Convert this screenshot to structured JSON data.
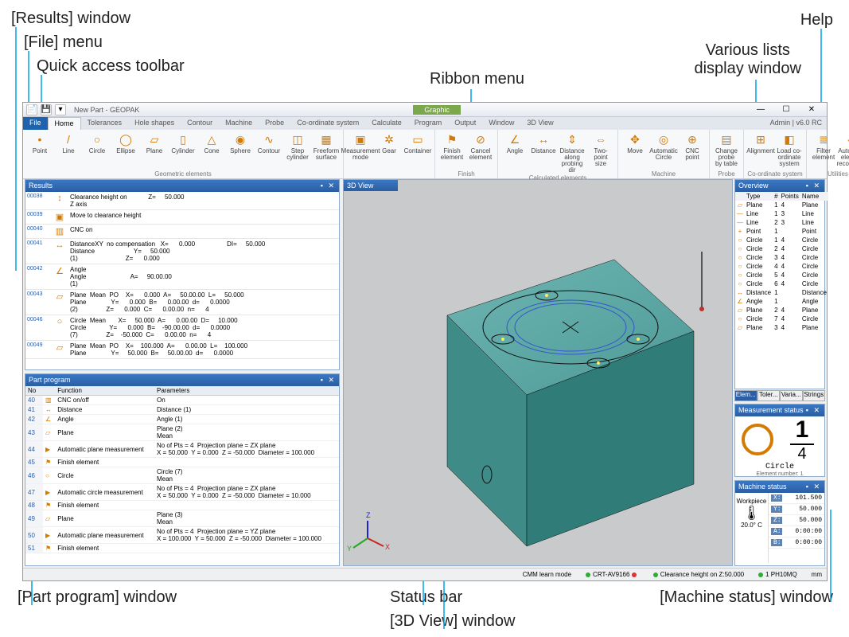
{
  "callouts": {
    "results_win": "[Results] window",
    "file_menu": "[File] menu",
    "quick_access": "Quick access toolbar",
    "ribbon_menu": "Ribbon menu",
    "help": "Help",
    "lists_window": "Various lists\ndisplay window",
    "part_program": "[Part program] window",
    "status_bar": "Status bar",
    "view3d": "[3D View] window",
    "meas_status": "[Measurement status] window",
    "mach_status": "[Machine status] window"
  },
  "title": "New Part - GEOPAK",
  "graphic_badge": "Graphic",
  "user": "Admin | v6.0 RC",
  "tabs": [
    "File",
    "Home",
    "Tolerances",
    "Hole shapes",
    "Contour",
    "Machine",
    "Probe",
    "Co-ordinate system",
    "Calculate",
    "Program",
    "Output",
    "Window",
    "3D View"
  ],
  "active_tab": 1,
  "ribbon": {
    "groups": [
      {
        "label": "Geometric elements",
        "buttons": [
          {
            "name": "Point",
            "icon": "•"
          },
          {
            "name": "Line",
            "icon": "/"
          },
          {
            "name": "Circle",
            "icon": "○"
          },
          {
            "name": "Ellipse",
            "icon": "◯"
          },
          {
            "name": "Plane",
            "icon": "▱"
          },
          {
            "name": "Cylinder",
            "icon": "▯"
          },
          {
            "name": "Cone",
            "icon": "△"
          },
          {
            "name": "Sphere",
            "icon": "◉"
          },
          {
            "name": "Contour",
            "icon": "∿"
          },
          {
            "name": "Step\ncylinder",
            "icon": "◫"
          },
          {
            "name": "Freeform\nsurface",
            "icon": "▦"
          }
        ]
      },
      {
        "label": "",
        "buttons": [
          {
            "name": "Measurement\nmode",
            "icon": "▣"
          },
          {
            "name": "Gear",
            "icon": "✲"
          },
          {
            "name": "Container",
            "icon": "▭"
          }
        ]
      },
      {
        "label": "Finish",
        "buttons": [
          {
            "name": "Finish\nelement",
            "icon": "⚑"
          },
          {
            "name": "Cancel\nelement",
            "icon": "⊘"
          }
        ]
      },
      {
        "label": "Calculated elements",
        "buttons": [
          {
            "name": "Angle",
            "icon": "∠"
          },
          {
            "name": "Distance",
            "icon": "↔"
          },
          {
            "name": "Distance along\nprobing dir",
            "icon": "⇕"
          },
          {
            "name": "Two-point\nsize",
            "icon": "⇔"
          }
        ]
      },
      {
        "label": "Machine",
        "buttons": [
          {
            "name": "Move",
            "icon": "✥"
          },
          {
            "name": "Automatic\nCircle",
            "icon": "◎"
          },
          {
            "name": "CNC\npoint",
            "icon": "⊕"
          }
        ]
      },
      {
        "label": "Probe",
        "buttons": [
          {
            "name": "Change probe\nby table",
            "icon": "▤"
          }
        ]
      },
      {
        "label": "Co-ordinate system",
        "buttons": [
          {
            "name": "Alignment",
            "icon": "⊞"
          },
          {
            "name": "Load co-ordinate\nsystem",
            "icon": "◧"
          }
        ]
      },
      {
        "label": "Utilities",
        "buttons": [
          {
            "name": "Filter\nelement",
            "icon": "≣"
          },
          {
            "name": "Automatic element\nrecognition",
            "icon": "◈"
          }
        ]
      }
    ]
  },
  "panes": {
    "results": "Results",
    "part_program": "Part program",
    "view3d": "3D View",
    "overview": "Overview",
    "meas_status": "Measurement status",
    "mach_status": "Machine status"
  },
  "results_rows": [
    {
      "id": "00038",
      "icon": "↕",
      "text": "Clearance height on            Z=     50.000\nZ axis"
    },
    {
      "id": "00039",
      "icon": "▣",
      "text": "Move to clearance height"
    },
    {
      "id": "00040",
      "icon": "▥",
      "text": "CNC on"
    },
    {
      "id": "00041",
      "icon": "↔",
      "text": "DistanceXY  no compensation   X=      0.000                  DI=     50.000\nDistance                      Y=     50.000\n(1)                           Z=      0.000"
    },
    {
      "id": "00042",
      "icon": "∠",
      "text": "Angle\nAngle                         A=     90.00.00\n(1)"
    },
    {
      "id": "00043",
      "icon": "▱",
      "text": "Plane  Mean  PO    X=      0.000  A=     50.00.00  L=     50.000\nPlane              Y=      0.000  B=      0.00.00  d=      0.0000\n(2)                Z=      0.000  C=      0.00.00  n=      4"
    },
    {
      "id": "00046",
      "icon": "○",
      "text": "Circle  Mean       X=     50.000  A=      0.00.00  D=     10.000\nCircle             Y=      0.000  B=    -90.00.00  d=      0.0000\n(7)                Z=    -50.000  C=      0.00.00  n=      4"
    },
    {
      "id": "00049",
      "icon": "▱",
      "text": "Plane  Mean  PO    X=    100.000  A=      0.00.00  L=    100.000\nPlane              Y=     50.000  B=     50.00.00  d=      0.0000"
    }
  ],
  "prog_headers": [
    "No",
    "",
    "Function",
    "Parameters"
  ],
  "prog_rows": [
    {
      "no": "40",
      "icon": "▥",
      "fn": "CNC on/off",
      "param": "On"
    },
    {
      "no": "41",
      "icon": "↔",
      "fn": "Distance",
      "param": "Distance (1)"
    },
    {
      "no": "42",
      "icon": "∠",
      "fn": "Angle",
      "param": "Angle (1)"
    },
    {
      "no": "43",
      "icon": "▱",
      "fn": "Plane",
      "param": "Plane (2)\nMean"
    },
    {
      "no": "44",
      "icon": "▶",
      "fn": "Automatic plane measurement",
      "param": "No of Pts = 4  Projection plane = ZX plane\nX = 50.000  Y = 0.000  Z = -50.000  Diameter = 100.000"
    },
    {
      "no": "45",
      "icon": "⚑",
      "fn": "Finish element",
      "param": ""
    },
    {
      "no": "46",
      "icon": "○",
      "fn": "Circle",
      "param": "Circle (7)\nMean"
    },
    {
      "no": "47",
      "icon": "▶",
      "fn": "Automatic circle measurement",
      "param": "No of Pts = 4  Projection plane = ZX plane\nX = 50.000  Y = 0.000  Z = -50.000  Diameter = 10.000"
    },
    {
      "no": "48",
      "icon": "⚑",
      "fn": "Finish element",
      "param": ""
    },
    {
      "no": "49",
      "icon": "▱",
      "fn": "Plane",
      "param": "Plane (3)\nMean"
    },
    {
      "no": "50",
      "icon": "▶",
      "fn": "Automatic plane measurement",
      "param": "No of Pts = 4  Projection plane = YZ plane\nX = 100.000  Y = 50.000  Z = -50.000  Diameter = 100.000"
    },
    {
      "no": "51",
      "icon": "⚑",
      "fn": "Finish element",
      "param": ""
    }
  ],
  "overview_headers": [
    "Type",
    "#",
    "Points",
    "Name"
  ],
  "overview_rows": [
    {
      "i": "▱",
      "t": "Plane",
      "n": "1",
      "p": "4",
      "nm": "Plane"
    },
    {
      "i": "—",
      "t": "Line",
      "n": "1",
      "p": "3",
      "nm": "Line"
    },
    {
      "i": "—",
      "t": "Line",
      "n": "2",
      "p": "3",
      "nm": "Line"
    },
    {
      "i": "+",
      "t": "Point",
      "n": "1",
      "p": "",
      "nm": "Point"
    },
    {
      "i": "○",
      "t": "Circle",
      "n": "1",
      "p": "4",
      "nm": "Circle"
    },
    {
      "i": "○",
      "t": "Circle",
      "n": "2",
      "p": "4",
      "nm": "Circle"
    },
    {
      "i": "○",
      "t": "Circle",
      "n": "3",
      "p": "4",
      "nm": "Circle"
    },
    {
      "i": "○",
      "t": "Circle",
      "n": "4",
      "p": "4",
      "nm": "Circle"
    },
    {
      "i": "○",
      "t": "Circle",
      "n": "5",
      "p": "4",
      "nm": "Circle"
    },
    {
      "i": "○",
      "t": "Circle",
      "n": "6",
      "p": "4",
      "nm": "Circle"
    },
    {
      "i": "↔",
      "t": "Distance",
      "n": "1",
      "p": "",
      "nm": "Distance"
    },
    {
      "i": "∠",
      "t": "Angle",
      "n": "1",
      "p": "",
      "nm": "Angle"
    },
    {
      "i": "▱",
      "t": "Plane",
      "n": "2",
      "p": "4",
      "nm": "Plane"
    },
    {
      "i": "○",
      "t": "Circle",
      "n": "7",
      "p": "4",
      "nm": "Circle"
    },
    {
      "i": "▱",
      "t": "Plane",
      "n": "3",
      "p": "4",
      "nm": "Plane"
    }
  ],
  "tabstrip": [
    "Elem...",
    "Toler...",
    "Varia...",
    "Strings"
  ],
  "meas": {
    "shape": "Circle",
    "numerator": "1",
    "denominator": "4",
    "sub": "Element number: 1"
  },
  "machine": {
    "temp_label": "Workpiece",
    "temp": "20.0° C",
    "coords": [
      {
        "k": "X:",
        "v": "101.500"
      },
      {
        "k": "Y:",
        "v": "50.000"
      },
      {
        "k": "Z:",
        "v": "50.000"
      },
      {
        "k": "A:",
        "v": "0:00:00"
      },
      {
        "k": "B:",
        "v": "0:00:00"
      }
    ]
  },
  "status": {
    "mode": "CMM learn mode",
    "probe": "CRT-AV9166",
    "clearance": "Clearance height on Z:50.000",
    "extra": "1 PH10MQ",
    "unit": "mm"
  }
}
